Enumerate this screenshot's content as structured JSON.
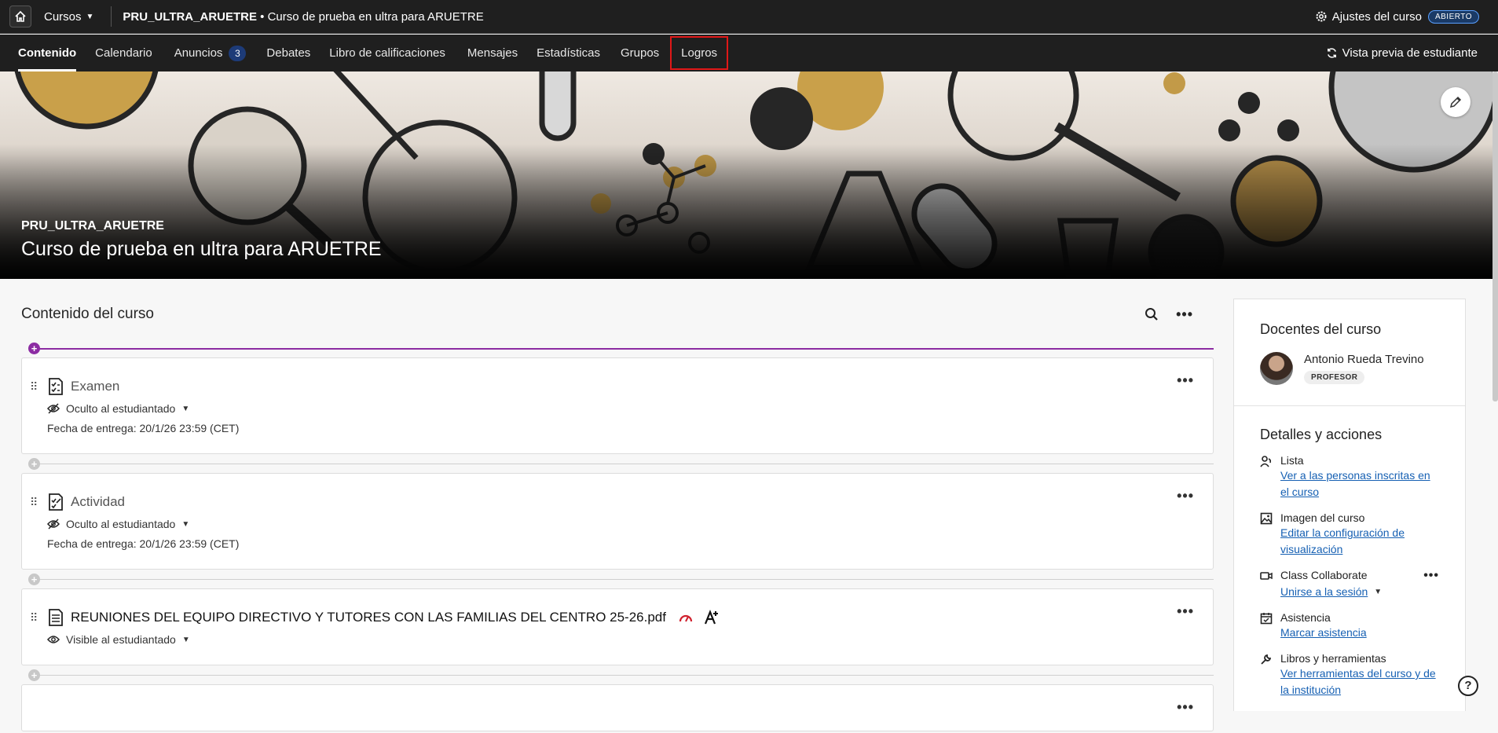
{
  "topbar": {
    "courses_label": "Cursos",
    "course_code": "PRU_ULTRA_ARUETRE",
    "course_name": "• Curso de prueba en ultra para ARUETRE",
    "settings_label": "Ajustes del curso",
    "status_badge": "ABIERTO"
  },
  "nav": {
    "items": [
      {
        "label": "Contenido"
      },
      {
        "label": "Calendario"
      },
      {
        "label": "Anuncios",
        "count": "3"
      },
      {
        "label": "Debates"
      },
      {
        "label": "Libro de calificaciones"
      },
      {
        "label": "Mensajes"
      },
      {
        "label": "Estadísticas"
      },
      {
        "label": "Grupos"
      },
      {
        "label": "Logros"
      }
    ],
    "preview_label": "Vista previa de estudiante"
  },
  "banner": {
    "code": "PRU_ULTRA_ARUETRE",
    "name": "Curso de prueba en ultra para ARUETRE"
  },
  "content": {
    "title": "Contenido del curso",
    "items": [
      {
        "title": "Examen",
        "visibility": "Oculto al estudiantado",
        "due": "Fecha de entrega: 20/1/26 23:59 (CET)"
      },
      {
        "title": "Actividad",
        "visibility": "Oculto al estudiantado",
        "due": "Fecha de entrega: 20/1/26 23:59 (CET)"
      },
      {
        "title": "REUNIONES DEL EQUIPO DIRECTIVO Y TUTORES CON LAS FAMILIAS DEL CENTRO 25-26.pdf",
        "visibility": "Visible al estudiantado"
      }
    ]
  },
  "side": {
    "teachers_title": "Docentes del curso",
    "teacher_name": "Antonio Rueda Trevino",
    "teacher_role": "PROFESOR",
    "details_title": "Detalles y acciones",
    "details": [
      {
        "label": "Lista",
        "link": "Ver a las personas inscritas en el curso",
        "icon": "roster-icon"
      },
      {
        "label": "Imagen del curso",
        "link": "Editar la configuración de visualización",
        "icon": "image-icon"
      },
      {
        "label": "Class Collaborate",
        "link": "Unirse a la sesión",
        "icon": "video-icon"
      },
      {
        "label": "Asistencia",
        "link": "Marcar asistencia",
        "icon": "attendance-icon"
      },
      {
        "label": "Libros y herramientas",
        "link": "Ver herramientas del curso y de la institución",
        "icon": "wrench-icon"
      }
    ]
  },
  "colors": {
    "accent": "#8c2ca3",
    "link": "#1660b3",
    "highlight": "#e01818"
  }
}
